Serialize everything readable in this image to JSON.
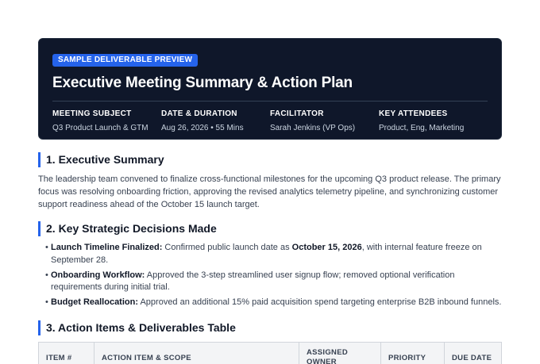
{
  "header": {
    "badge": "SAMPLE DELIVERABLE PREVIEW",
    "title": "Executive Meeting Summary & Action Plan",
    "meta": [
      {
        "label": "MEETING SUBJECT",
        "value": "Q3 Product Launch & GTM"
      },
      {
        "label": "DATE & DURATION",
        "value": "Aug 26, 2026 • 55 Mins"
      },
      {
        "label": "FACILITATOR",
        "value": "Sarah Jenkins (VP Ops)"
      },
      {
        "label": "KEY ATTENDEES",
        "value": "Product, Eng, Marketing"
      }
    ]
  },
  "summary": {
    "heading": "1. Executive Summary",
    "text": "The leadership team convened to finalize cross-functional milestones for the upcoming Q3 product release. The primary focus was resolving onboarding friction, approving the revised analytics telemetry pipeline, and synchronizing customer support readiness ahead of the October 15 launch target."
  },
  "decisions": {
    "heading": "2. Key Strategic Decisions Made",
    "items": [
      {
        "title": "Launch Timeline Finalized:",
        "pre": " Confirmed public launch date as ",
        "strong": "October 15, 2026",
        "post": ", with internal feature freeze on September 28."
      },
      {
        "title": "Onboarding Workflow:",
        "pre": " Approved the 3-step streamlined user signup flow; removed optional verification requirements during initial trial.",
        "strong": "",
        "post": ""
      },
      {
        "title": "Budget Reallocation:",
        "pre": " Approved an additional 15% paid acquisition spend targeting enterprise B2B inbound funnels.",
        "strong": "",
        "post": ""
      }
    ]
  },
  "actions": {
    "heading": "3. Action Items & Deliverables Table",
    "columns": [
      "ITEM #",
      "ACTION ITEM & SCOPE",
      "ASSIGNED OWNER",
      "PRIORITY",
      "DUE DATE"
    ]
  }
}
